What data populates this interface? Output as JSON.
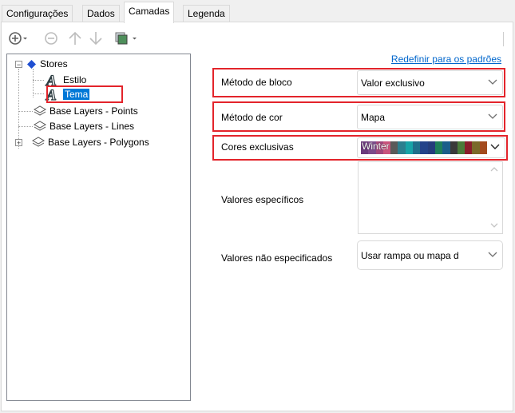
{
  "tabs": [
    "Configurações",
    "Dados",
    "Camadas",
    "Legenda"
  ],
  "active_tab": "Camadas",
  "toolbar": {
    "icons": [
      "add-icon",
      "remove-icon",
      "move-up-icon",
      "move-down-icon",
      "layer-copy-icon"
    ]
  },
  "tree": {
    "root": "Stores",
    "children": [
      "Estilo",
      "Tema"
    ],
    "selected": "Tema",
    "layers": [
      "Base Layers - Points",
      "Base Layers - Lines",
      "Base Layers - Polygons"
    ]
  },
  "form": {
    "reset_link": "Redefinir para os padrões",
    "block_method_label": "Método de bloco",
    "block_method_value": "Valor exclusivo",
    "color_method_label": "Método de cor",
    "color_method_value": "Mapa",
    "exclusive_colors_label": "Cores exclusivas",
    "exclusive_colors_value": "Winter",
    "specific_values_label": "Valores específicos",
    "unspecified_values_label": "Valores não especificados",
    "unspecified_values_value": "Usar rampa ou mapa d"
  },
  "colors": {
    "highlight": "#e3242b",
    "selection": "#0078d7",
    "link": "#0066cc",
    "palette": [
      "#6b3a7c",
      "#7c4a8a",
      "#a1467a",
      "#c9537c",
      "#5a5a5a",
      "#2b7f8f",
      "#17a3a7",
      "#1f6f8b",
      "#23428a",
      "#243c7c",
      "#1e7f5a",
      "#1b5e8a",
      "#3a3a3a",
      "#4a7c3a",
      "#8a1e2b",
      "#7a6a2a",
      "#a34a1e"
    ]
  }
}
